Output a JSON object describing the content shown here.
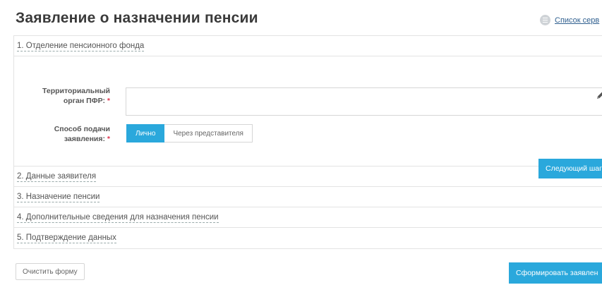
{
  "page": {
    "title": "Заявление о назначении пенсии",
    "services_link": "Список серв"
  },
  "sections": [
    {
      "label": "1. Отделение пенсионного фонда"
    },
    {
      "label": "2. Данные заявителя"
    },
    {
      "label": "3. Назначение пенсии"
    },
    {
      "label": "4. Дополнительные сведения для назначения пенсии"
    },
    {
      "label": "5. Подтверждение данных"
    }
  ],
  "section1": {
    "territorial_label_line1": "Территориальный",
    "territorial_label_line2": "орган ПФР:",
    "territorial_value": "",
    "method_label_line1": "Способ подачи",
    "method_label_line2": "заявления:",
    "required_mark": "*",
    "method_options": [
      "Лично",
      "Через представителя"
    ],
    "method_selected": "Лично",
    "next_button": "Следующий шаг"
  },
  "footer": {
    "clear_button": "Очистить форму",
    "submit_button": "Сформировать заявлен"
  },
  "colors": {
    "accent": "#2aa8dc",
    "required": "#e0334d",
    "link": "#2f5f8f"
  },
  "icons": {
    "services": "list-icon",
    "edit": "pencil-icon"
  }
}
